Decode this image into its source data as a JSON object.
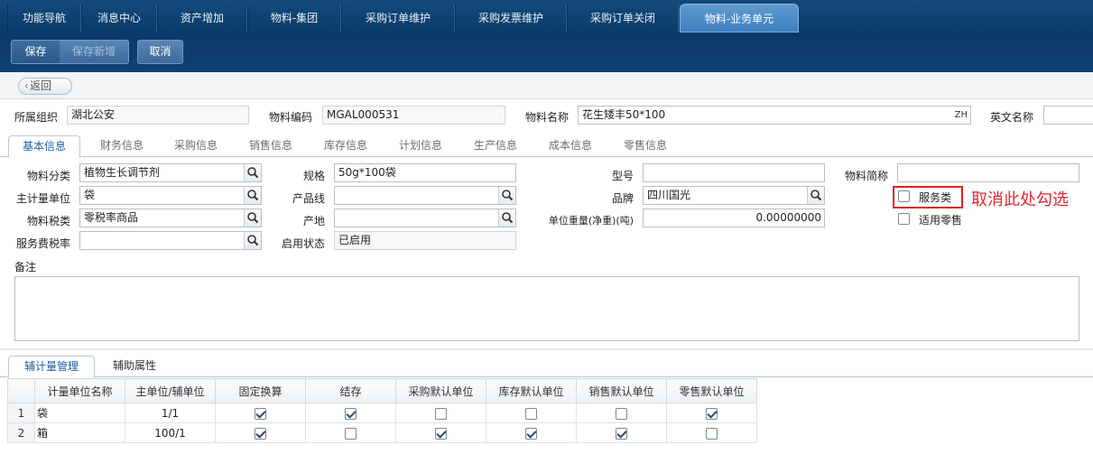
{
  "top_tabs": [
    "功能导航",
    "消息中心",
    "资产增加",
    "物料-集团",
    "采购订单维护",
    "采购发票维护",
    "采购订单关闭",
    "物料-业务单元"
  ],
  "toolbar": {
    "save": "保存",
    "save_new": "保存新增",
    "cancel": "取消"
  },
  "back_label": "返回",
  "header": {
    "org_label": "所属组织",
    "org_value": "湖北公安",
    "code_label": "物料编码",
    "code_value": "MGAL000531",
    "name_label": "物料名称",
    "name_value": "花生矮丰50*100",
    "name_lang": "ZH",
    "en_label": "英文名称",
    "en_value": ""
  },
  "form_tabs": [
    "基本信息",
    "财务信息",
    "采购信息",
    "销售信息",
    "库存信息",
    "计划信息",
    "生产信息",
    "成本信息",
    "零售信息"
  ],
  "form": {
    "category_label": "物料分类",
    "category_value": "植物生长调节剂",
    "spec_label": "规格",
    "spec_value": "50g*100袋",
    "model_label": "型号",
    "model_value": "",
    "short_label": "物料简称",
    "short_value": "",
    "unit_label": "主计量单位",
    "unit_value": "袋",
    "line_label": "产品线",
    "line_value": "",
    "brand_label": "品牌",
    "brand_value": "四川国光",
    "service_label": "服务类",
    "tax_label": "物料税类",
    "tax_value": "零税率商品",
    "origin_label": "产地",
    "origin_value": "",
    "weight_label": "单位重量(净重)(吨)",
    "weight_value": "0.00000000",
    "retail_label": "适用零售",
    "fee_label": "服务费税率",
    "fee_value": "",
    "status_label": "启用状态",
    "status_value": "已启用",
    "notes_label": "备注"
  },
  "annotation": "取消此处勾选",
  "bottom_tabs": [
    "辅计量管理",
    "辅助属性"
  ],
  "grid": {
    "columns": [
      "计量单位名称",
      "主单位/辅单位",
      "固定换算",
      "结存",
      "采购默认单位",
      "库存默认单位",
      "销售默认单位",
      "零售默认单位"
    ],
    "rows": [
      {
        "no": "1",
        "unit": "袋",
        "ratio": "1/1",
        "checks": [
          true,
          true,
          false,
          false,
          false,
          true
        ]
      },
      {
        "no": "2",
        "unit": "箱",
        "ratio": "100/1",
        "checks": [
          true,
          false,
          true,
          true,
          true,
          false
        ]
      }
    ]
  }
}
